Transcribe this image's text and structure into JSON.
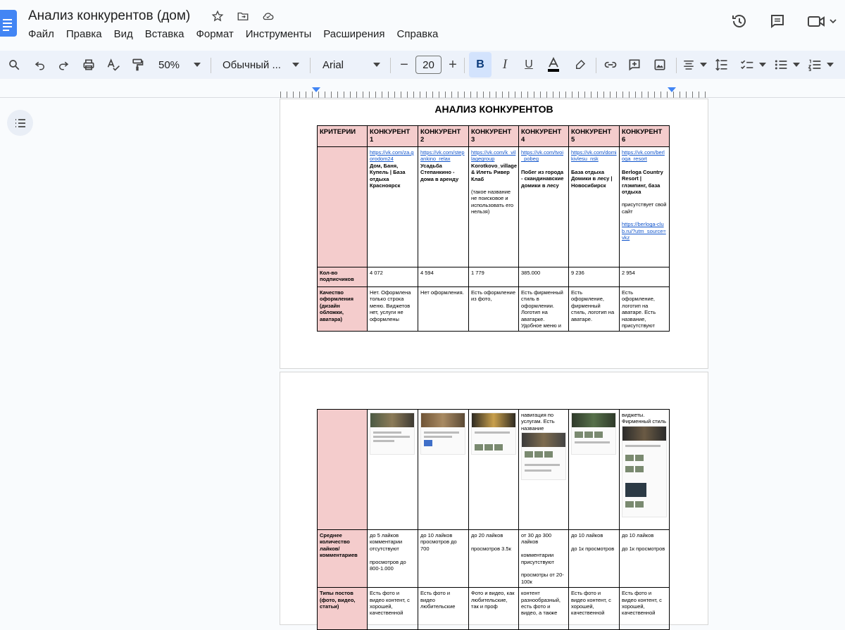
{
  "title": "Анализ конкурентов (дом)",
  "menu": [
    "Файл",
    "Правка",
    "Вид",
    "Вставка",
    "Формат",
    "Инструменты",
    "Расширения",
    "Справка"
  ],
  "toolbar": {
    "zoom": "50%",
    "style": "Обычный ...",
    "font": "Arial",
    "font_size": "20"
  },
  "doc": {
    "heading": "АНАЛИЗ КОНКУРЕНТОВ",
    "criteria_header": "КРИТЕРИИ",
    "competitors": [
      {
        "header": "КОНКУРЕНТ 1",
        "link": "https://vk.com/za.gorodom24",
        "name": "Дом, Баня, Купель | База отдыха Красноярск",
        "note": "",
        "link2": "",
        "subscribers": "4 072",
        "design": "Нет. Оформлена только строка меню. Виджетов нет, услуги не оформлены",
        "likes": "до 5 лайков комментарии отсутствуют\n\nпросмотров до 800-1.000",
        "post_types": "Есть фото и видео контент, с хорошей, качественной"
      },
      {
        "header": "КОНКУРЕНТ 2",
        "link": "https://vk.com/stepankino_relax",
        "name": "Усадьба Степанкино - дома в аренду",
        "note": "",
        "link2": "",
        "subscribers": "4 594",
        "design": "Нет оформления.",
        "likes": "до 10 лайков просмотров до 700",
        "post_types": "Есть фото и видео любительские"
      },
      {
        "header": "КОНКУРЕНТ 3",
        "link": "https://vk.com/k_villagegroup",
        "name": "Korotkovo_village & Илеть Ривер Клаб",
        "note": "(такое название не поисковое и использовать его нельзя)",
        "link2": "",
        "subscribers": "1 779",
        "design": "Есть оформление из фото,",
        "likes": "до 20 лайков\n\nпросмотров 3.5к",
        "post_types": "Фото и видео, как любительские, так и проф"
      },
      {
        "header": "КОНКУРЕНТ 4",
        "link": "https://vk.com/tvoi_pobeg",
        "name": "Побег из города - скандинавские домики в лесу",
        "note": "",
        "link2": "",
        "subscribers": "385.000",
        "design": "Есть фирменный стиль в оформлении. Логотип на аватарке. Удобное меню и",
        "design2": "навигация по услугам. Есть название",
        "likes": "от 30 до 300 лайков\n\nкомментарии присутствуют\n\nпросмотры от 20-100к",
        "post_types": "контент разнообразный, есть фото и видео, а также"
      },
      {
        "header": "КОНКУРЕНТ 5",
        "link": "https://vk.com/domikivlesu_nsk",
        "name": "База отдыха Домики в лесу | Новосибирск",
        "note": "",
        "link2": "",
        "subscribers": "9 236",
        "design": "Есть оформление, фирменный стиль, логотип на аватаре.",
        "likes": "до 10 лайков\n\nдо 1к просмотров",
        "post_types": "Есть фото и видео контент, с хорошей, качественной"
      },
      {
        "header": "КОНКУРЕНТ 6",
        "link": "https://vk.com/berloga_resort",
        "name": "Berloga Country Resort | глэмпинг, база отдыха",
        "note": "присутствует свой сайт",
        "link2": "https://berloga-club.ru/?utm_source=vkz",
        "subscribers": "2 954",
        "design": "Есть оформление, логотип на аватаре. Есть название, присутствуют",
        "design2": "виджеты. Фирменный стиль",
        "likes": "до 10 лайков\n\nдо 1к просмотров",
        "post_types": "Есть фото и видео контент, с хорошей, качественной"
      }
    ],
    "rows": {
      "subscribers_label": "Кол-во подписчиков",
      "design_label": "Качество оформления (дизайн обложки, аватара)",
      "likes_label": "Среднее количество лайков/комментариев",
      "post_types_label": "Типы постов (фото, видео, статьи)"
    }
  }
}
